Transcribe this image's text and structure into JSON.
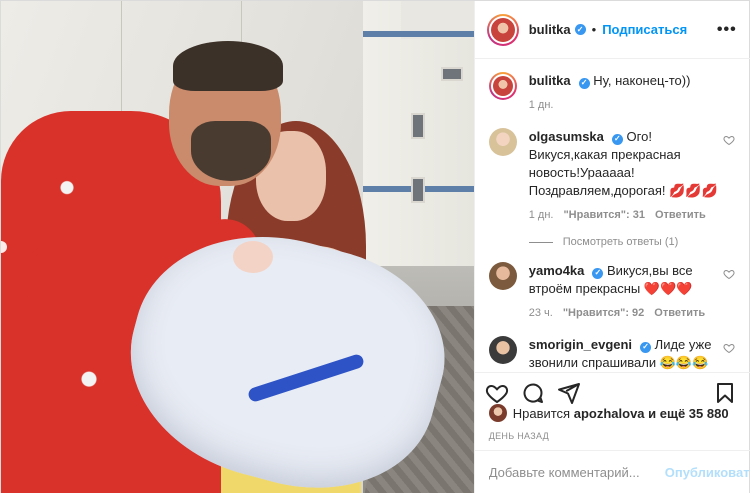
{
  "post": {
    "author": "bulitka",
    "follow_label": "Подписаться",
    "more_label": "•••",
    "dot": "•"
  },
  "caption": {
    "username": "bulitka",
    "text": "Ну, наконец-то))",
    "age": "1 дн."
  },
  "comments": [
    {
      "username": "olgasumska",
      "verified": true,
      "text": "Ого!Викуся,какая прекрасная новость!Урааааа! Поздравляем,дорогая!",
      "emoji": "💋💋💋",
      "age": "1 дн.",
      "likes": "\"Нравится\": 31",
      "reply_label": "Ответить",
      "view_replies": "Посмотреть ответы (1)"
    },
    {
      "username": "yamo4ka",
      "verified": true,
      "text": "Викуся,вы все втроём прекрасны",
      "emoji": "❤️❤️❤️",
      "age": "23 ч.",
      "likes": "\"Нравится\": 92",
      "reply_label": "Ответить"
    },
    {
      "username": "smorigin_evgeni",
      "verified": true,
      "text": "Лиде уже звонили спрашивали",
      "emoji": "😂😂😂",
      "age": "",
      "likes": "",
      "reply_label": ""
    }
  ],
  "actions": {
    "icons": [
      "heart-icon",
      "comment-icon",
      "share-icon",
      "bookmark-icon"
    ]
  },
  "likes": {
    "prefix": "Нравится",
    "user": "apozhalova",
    "suffix": "и ещё 35 880"
  },
  "date_label": "ДЕНЬ НАЗАД",
  "add_comment": {
    "placeholder": "Добавьте комментарий...",
    "publish_label": "Опубликовать"
  },
  "colors": {
    "link": "#0095f6",
    "verified": "#3897f0",
    "muted": "#8e8e8e",
    "publish_disabled": "#b2dffc"
  }
}
